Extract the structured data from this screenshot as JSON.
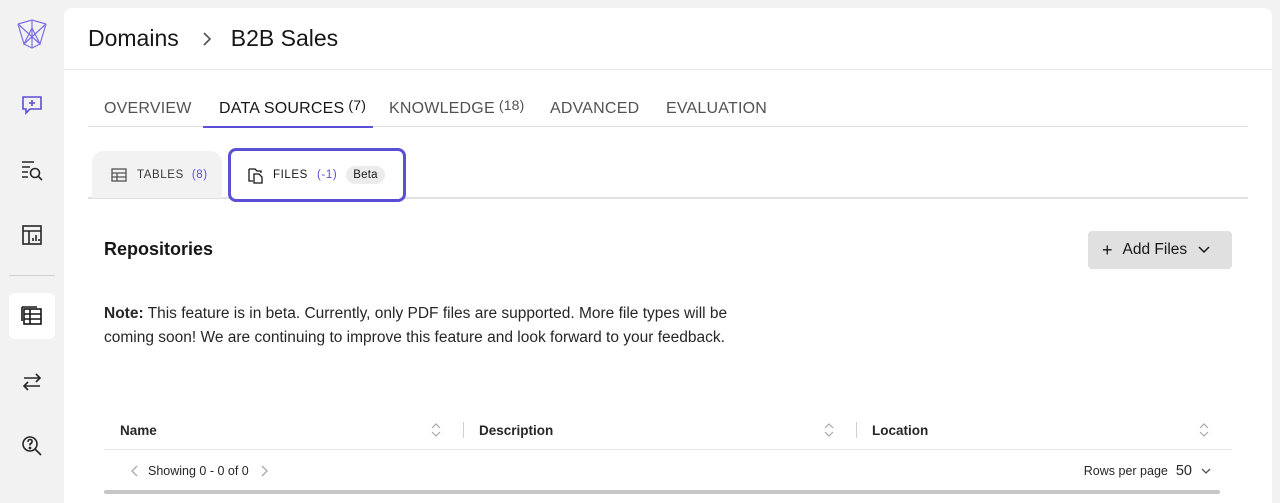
{
  "sidebar": {
    "items": [
      {
        "name": "new-chat",
        "icon": "chat-plus-icon"
      },
      {
        "name": "search",
        "icon": "search-list-icon"
      },
      {
        "name": "dashboard",
        "icon": "chart-table-icon"
      },
      {
        "name": "domains",
        "icon": "table-icon",
        "active": true
      },
      {
        "name": "transfer",
        "icon": "arrows-icon"
      },
      {
        "name": "help-search",
        "icon": "help-search-icon"
      }
    ]
  },
  "breadcrumb": {
    "root": "Domains",
    "current": "B2B Sales"
  },
  "tabs": [
    {
      "label": "OVERVIEW",
      "count": ""
    },
    {
      "label": "DATA SOURCES",
      "count": "(7)",
      "active": true
    },
    {
      "label": "KNOWLEDGE",
      "count": "(18)"
    },
    {
      "label": "ADVANCED",
      "count": ""
    },
    {
      "label": "EVALUATION",
      "count": ""
    }
  ],
  "subtabs": {
    "tables": {
      "label": "TABLES",
      "count": "(8)"
    },
    "files": {
      "label": "FILES",
      "count": "(-1)",
      "badge": "Beta"
    }
  },
  "section": {
    "title": "Repositories",
    "add_button": "Add Files"
  },
  "note": {
    "prefix": "Note:",
    "text": "This feature is in beta. Currently, only PDF files are supported. More file types will be coming soon! We are continuing to improve this feature and look forward to your feedback."
  },
  "table": {
    "columns": [
      "Name",
      "Description",
      "Location"
    ],
    "rows": []
  },
  "pagination": {
    "showing": "Showing 0 - 0 of 0",
    "rows_label": "Rows per page",
    "rows_value": "50"
  },
  "colors": {
    "accent": "#5b4fd6",
    "background": "#f2f2f2"
  }
}
